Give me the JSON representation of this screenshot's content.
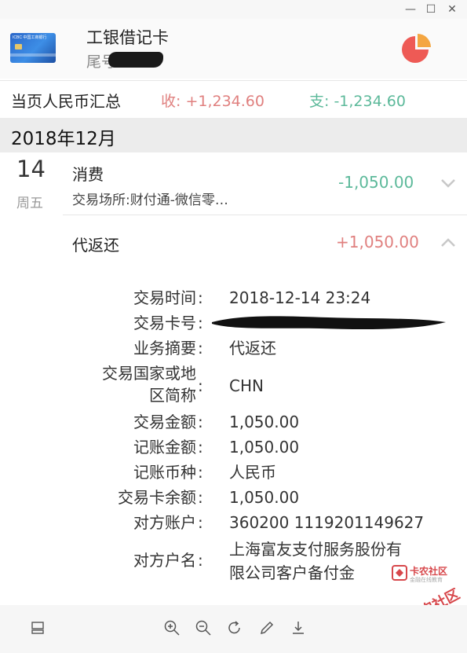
{
  "window": {
    "minimize": "—",
    "maximize": "☐",
    "close": "✕"
  },
  "card": {
    "title": "工银借记卡",
    "tail_label": "尾号",
    "card_icon": "card-image-icon",
    "stats_icon": "pie-chart-icon",
    "image_text": "ICBC 中国工商银行"
  },
  "summary": {
    "label": "当页人民币汇总",
    "income": "收: +1,234.60",
    "expense": "支: -1,234.60",
    "income_color": "#e0807f",
    "expense_color": "#5cb99a"
  },
  "month": "2018年12月",
  "transaction": {
    "day": "14",
    "weekday": "周五",
    "title": "消费",
    "subtitle": "交易场所:财付通-微信零…",
    "amount": "-1,050.00",
    "expand_icon": "chevron-down-icon"
  },
  "refund": {
    "title": "代返还",
    "amount": "+1,050.00",
    "collapse_icon": "chevron-up-icon",
    "details": [
      {
        "label": "交易时间",
        "value": "2018-12-14 23:24"
      },
      {
        "label": "交易卡号",
        "value": ""
      },
      {
        "label": "业务摘要",
        "value": "代返还"
      },
      {
        "label": "交易国家或地区简称",
        "label_line1": "交易国家或地",
        "label_line2": "区简称",
        "value": "CHN"
      },
      {
        "label": "交易金额",
        "value": "1,050.00"
      },
      {
        "label": "记账金额",
        "value": "1,050.00"
      },
      {
        "label": "记账币种",
        "value": "人民币"
      },
      {
        "label": "交易卡余额",
        "value": "1,050.00"
      },
      {
        "label": "对方账户",
        "value": "360200 1119201149627"
      },
      {
        "label": "对方户名",
        "value_line1": "上海富友支付服务股份有",
        "value_line2": "限公司客户备付金"
      }
    ],
    "colon": ":"
  },
  "watermark": {
    "name": "卡农社区",
    "sub": "金融在线教育",
    "big": "卡农社区"
  },
  "toolbar": {
    "icons": [
      "layout-icon",
      "zoom-in-icon",
      "zoom-out-icon",
      "rotate-icon",
      "edit-icon",
      "download-icon"
    ]
  }
}
